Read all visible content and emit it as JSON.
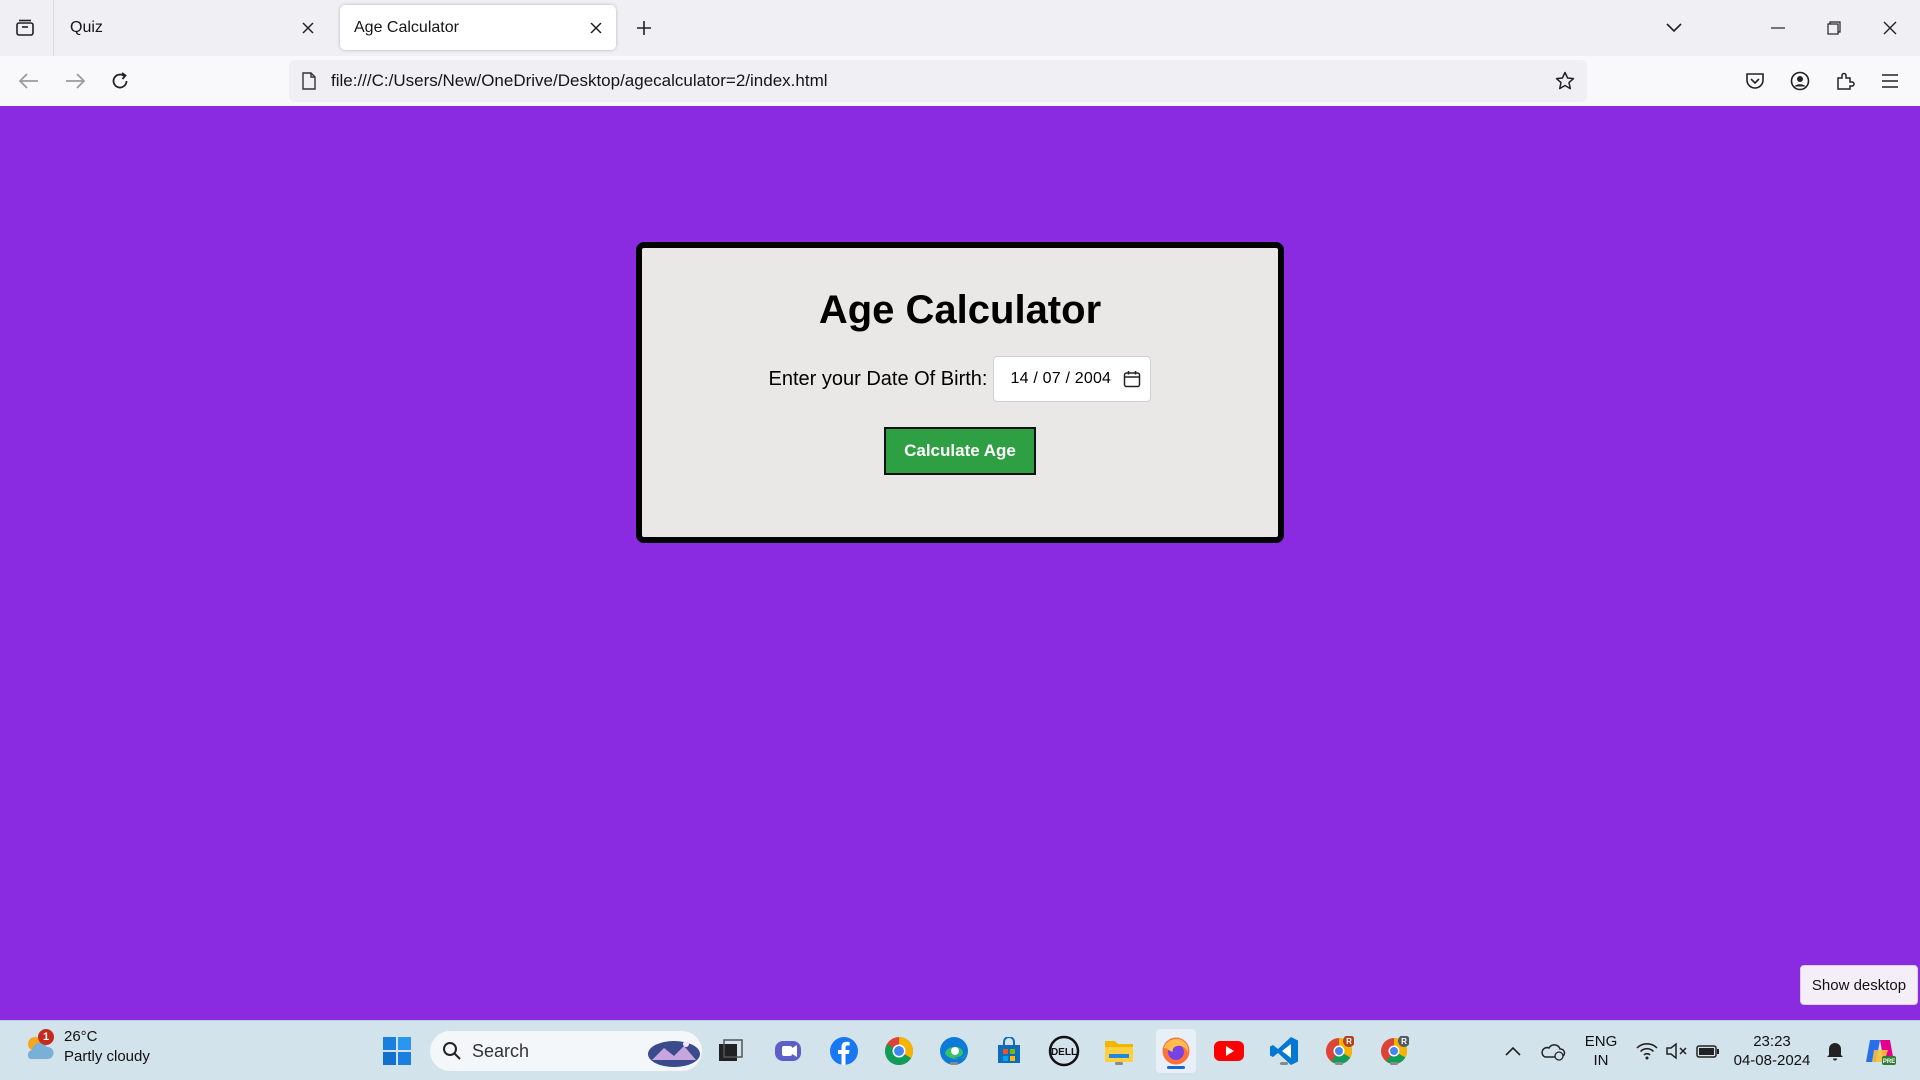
{
  "browser": {
    "tabs": [
      {
        "title": "Quiz",
        "active": false
      },
      {
        "title": "Age Calculator",
        "active": true
      }
    ],
    "url": "file:///C:/Users/New/OneDrive/Desktop/agecalculator=2/index.html"
  },
  "page": {
    "background": "#8a2be2",
    "card": {
      "title": "Age Calculator",
      "dob_label": "Enter your Date Of Birth:",
      "dob_day": "14",
      "dob_month": "07",
      "dob_year": "2004",
      "button_label": "Calculate Age",
      "button_color": "#2ea043"
    }
  },
  "tooltip": "Show desktop",
  "taskbar": {
    "weather": {
      "temp": "26°C",
      "condition": "Partly cloudy",
      "badge": "1"
    },
    "search_placeholder": "Search",
    "language": {
      "line1": "ENG",
      "line2": "IN"
    },
    "clock": {
      "time": "23:23",
      "date": "04-08-2024"
    },
    "pinned_apps": [
      "windows-start",
      "task-view",
      "teams",
      "facebook",
      "chrome",
      "edge",
      "microsoft-store",
      "dell",
      "file-explorer",
      "firefox",
      "youtube",
      "vscode",
      "chrome-profile-r",
      "chrome-profile-r2"
    ]
  }
}
